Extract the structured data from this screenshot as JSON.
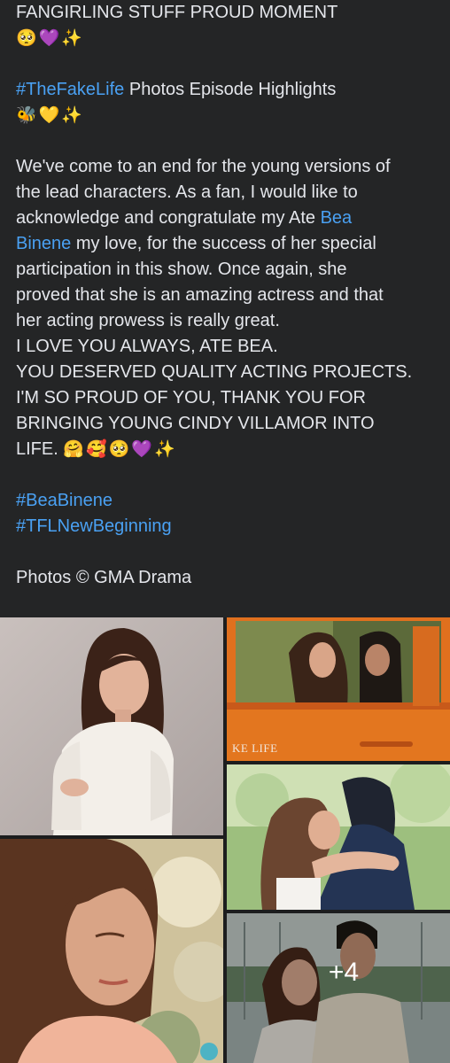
{
  "post": {
    "title": "FANGIRLING STUFF PROUD MOMENT",
    "title_emojis": "🥺💜✨",
    "hashtag_main": "#TheFakeLife",
    "highlights_text": " Photos Episode Highlights",
    "highlights_emojis": "🐝💛✨",
    "body_lines": [
      "We've come to an end for the young versions of",
      "the lead characters. As a fan, I would like to",
      "acknowledge and congratulate my Ate "
    ],
    "mention_first": "Bea",
    "mention_last": "Binene",
    "after_mention": "  my love, for the success of her special",
    "body_lines_2": [
      "participation in this show. Once again, she",
      "proved that she is an amazing actress and that",
      "her acting prowess is really great.",
      "I LOVE YOU ALWAYS, ATE BEA.",
      "YOU DESERVED QUALITY ACTING PROJECTS.",
      "I'M SO PROUD OF YOU, THANK YOU FOR",
      "BRINGING YOUNG CINDY VILLAMOR INTO"
    ],
    "last_line": "LIFE. ",
    "last_line_emojis": "🤗🥰🥺💜✨",
    "hashtags": [
      "#BeaBinene",
      "#TFLNewBeginning"
    ],
    "credit": "Photos © GMA Drama"
  },
  "photos": {
    "watermark": "KE LIFE",
    "more_count": "+4"
  },
  "colors": {
    "background": "#242526",
    "text": "#e4e6eb",
    "link": "#4aa1f3"
  }
}
